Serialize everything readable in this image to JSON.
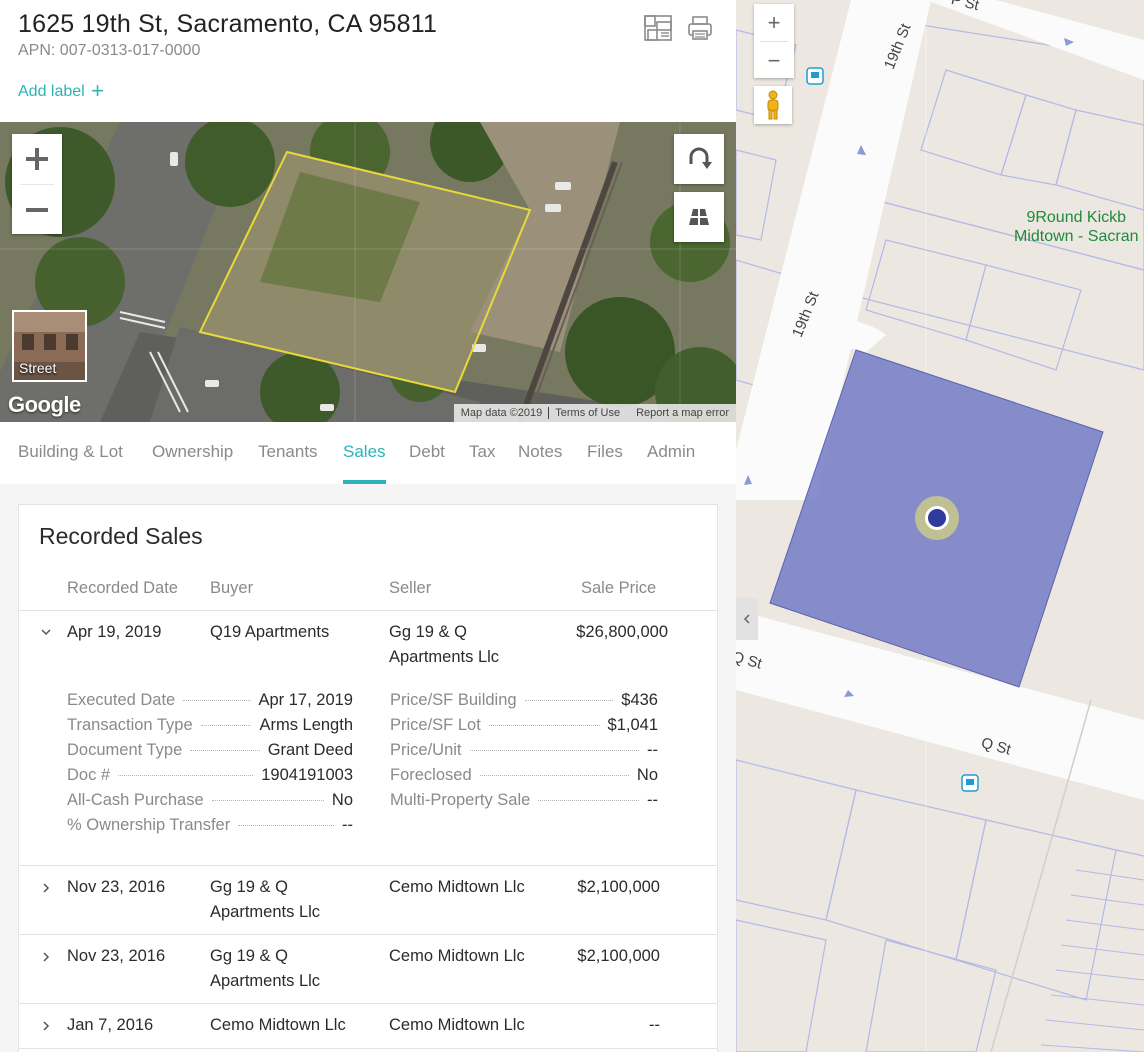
{
  "header": {
    "address": "1625 19th St, Sacramento, CA 95811",
    "apn": "APN: 007-0313-017-0000",
    "add_label": "Add label",
    "add_label_plus": "+"
  },
  "satellite": {
    "street_label": "Street",
    "google_logo": "Google",
    "attribution": {
      "map_data": "Map data ©2019",
      "terms": "Terms of Use",
      "report": "Report a map error"
    }
  },
  "tabs": [
    {
      "label": "Building & Lot",
      "active": false
    },
    {
      "label": "Ownership",
      "active": false
    },
    {
      "label": "Tenants",
      "active": false
    },
    {
      "label": "Sales",
      "active": true
    },
    {
      "label": "Debt",
      "active": false
    },
    {
      "label": "Tax",
      "active": false
    },
    {
      "label": "Notes",
      "active": false
    },
    {
      "label": "Files",
      "active": false
    },
    {
      "label": "Admin",
      "active": false
    }
  ],
  "sales": {
    "title": "Recorded Sales",
    "columns": [
      "Recorded Date",
      "Buyer",
      "Seller",
      "Sale Price"
    ],
    "rows": [
      {
        "date": "Apr 19, 2019",
        "buyer": "Q19 Apartments",
        "seller_line1": "Gg 19 & Q",
        "seller_line2": "Apartments Llc",
        "price": "$26,800,000",
        "expanded": true
      },
      {
        "date": "Nov 23, 2016",
        "buyer_line1": "Gg 19 & Q",
        "buyer_line2": "Apartments Llc",
        "seller": "Cemo Midtown Llc",
        "price": "$2,100,000",
        "expanded": false
      },
      {
        "date": "Nov 23, 2016",
        "buyer_line1": "Gg 19 & Q",
        "buyer_line2": "Apartments Llc",
        "seller": "Cemo Midtown Llc",
        "price": "$2,100,000",
        "expanded": false
      },
      {
        "date": "Jan 7, 2016",
        "buyer": "Cemo Midtown Llc",
        "seller": "Cemo Midtown Llc",
        "price": "--",
        "expanded": false
      }
    ],
    "details_left": [
      {
        "key": "Executed Date",
        "value": "Apr 17, 2019"
      },
      {
        "key": "Transaction Type",
        "value": "Arms Length"
      },
      {
        "key": "Document Type",
        "value": "Grant Deed"
      },
      {
        "key": "Doc #",
        "value": "1904191003"
      },
      {
        "key": "All-Cash Purchase",
        "value": "No"
      },
      {
        "key": "% Ownership Transfer",
        "value": "--"
      }
    ],
    "details_right": [
      {
        "key": "Price/SF Building",
        "value": "$436"
      },
      {
        "key": "Price/SF Lot",
        "value": "$1,041"
      },
      {
        "key": "Price/Unit",
        "value": "--"
      },
      {
        "key": "Foreclosed",
        "value": "No"
      },
      {
        "key": "Multi-Property Sale",
        "value": "--"
      }
    ]
  },
  "map": {
    "zoom_in": "+",
    "zoom_out": "−",
    "street_labels": {
      "top_p": "P St",
      "nineteenth_top": "19th St",
      "nineteenth_mid": "19th St",
      "q_st": "Q St",
      "q_left": "Q St"
    },
    "poi_line1": "9Round Kickb",
    "poi_line2": "Midtown - Sacran",
    "parcel_color": "#7b82c8",
    "marker_color": "#2f3a9a",
    "poi_color": "#1f8a3a"
  },
  "colors": {
    "accent": "#2bb3b8"
  }
}
